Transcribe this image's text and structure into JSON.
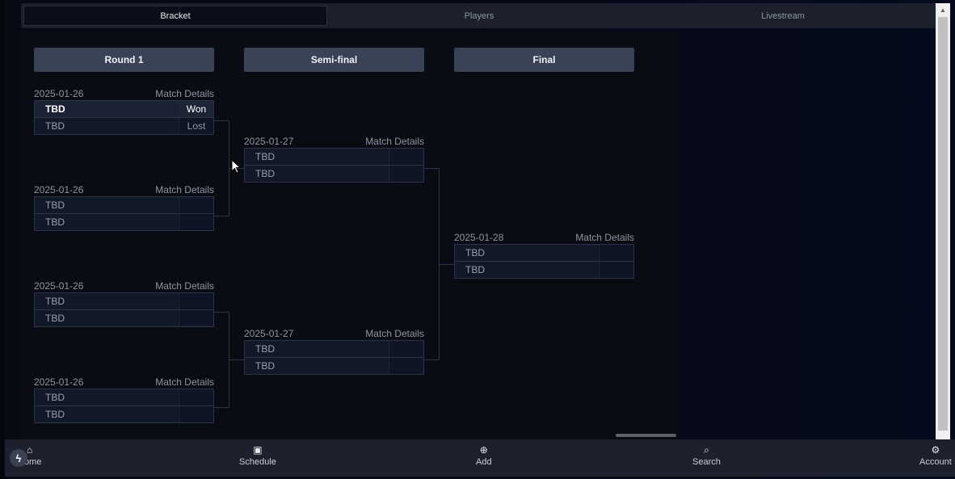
{
  "tabs": [
    {
      "label": "Bracket",
      "active": true
    },
    {
      "label": "Players",
      "active": false
    },
    {
      "label": "Livestream",
      "active": false
    }
  ],
  "rounds": [
    {
      "label": "Round 1"
    },
    {
      "label": "Semi-final"
    },
    {
      "label": "Final"
    }
  ],
  "details_label": "Match Details",
  "round1": [
    {
      "date": "2025-01-26",
      "p1": "TBD",
      "r1": "Won",
      "p2": "TBD",
      "r2": "Lost"
    },
    {
      "date": "2025-01-26",
      "p1": "TBD",
      "r1": "",
      "p2": "TBD",
      "r2": ""
    },
    {
      "date": "2025-01-26",
      "p1": "TBD",
      "r1": "",
      "p2": "TBD",
      "r2": ""
    },
    {
      "date": "2025-01-26",
      "p1": "TBD",
      "r1": "",
      "p2": "TBD",
      "r2": ""
    }
  ],
  "semifinal": [
    {
      "date": "2025-01-27",
      "p1": "TBD",
      "r1": "",
      "p2": "TBD",
      "r2": ""
    },
    {
      "date": "2025-01-27",
      "p1": "TBD",
      "r1": "",
      "p2": "TBD",
      "r2": ""
    }
  ],
  "final": [
    {
      "date": "2025-01-28",
      "p1": "TBD",
      "r1": "",
      "p2": "TBD",
      "r2": ""
    }
  ],
  "nav": {
    "home": "Home",
    "schedule": "Schedule",
    "add": "Add",
    "search": "Search",
    "account": "Account"
  },
  "icons": {
    "home": "home-icon",
    "schedule": "calendar-icon",
    "add": "plus-circle-icon",
    "search": "search-icon",
    "account": "gear-icon"
  },
  "colors": {
    "background": "#05070f",
    "header": "#3a4256",
    "nav": "#1c212d"
  }
}
